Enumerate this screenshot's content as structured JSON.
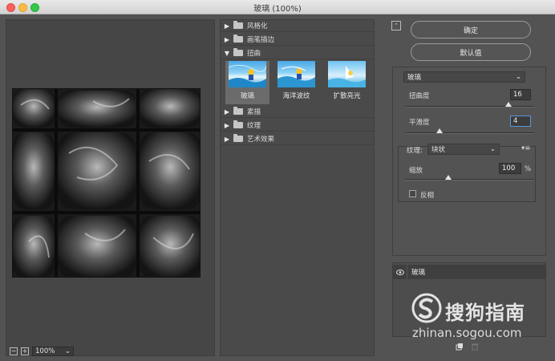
{
  "window": {
    "title": "玻璃 (100%)"
  },
  "preview": {
    "zoom": "100%",
    "zoom_out_icon": "minus-box-icon",
    "zoom_in_icon": "plus-box-icon"
  },
  "browser": {
    "categories_top": [
      {
        "label": "风格化",
        "expanded": false
      },
      {
        "label": "画笔描边",
        "expanded": false
      },
      {
        "label": "扭曲",
        "expanded": true
      }
    ],
    "thumbnails": [
      {
        "label": "玻璃",
        "selected": true
      },
      {
        "label": "海洋波纹",
        "selected": false
      },
      {
        "label": "扩散亮光",
        "selected": false
      }
    ],
    "categories_bottom": [
      {
        "label": "素描",
        "expanded": false
      },
      {
        "label": "纹理",
        "expanded": false
      },
      {
        "label": "艺术效果",
        "expanded": false
      }
    ]
  },
  "actions": {
    "ok_label": "确定",
    "default_label": "默认值"
  },
  "settings": {
    "filter_select": "玻璃",
    "distortion": {
      "label": "扭曲度",
      "value": "16",
      "max": 20
    },
    "smoothness": {
      "label": "平滑度",
      "value": "4",
      "max": 15
    },
    "texture": {
      "label": "纹理:",
      "value": "块状"
    },
    "scaling": {
      "label": "缩放",
      "value": "100",
      "unit": "%",
      "min": 50,
      "max": 200
    },
    "invert": {
      "label": "反相",
      "checked": false
    }
  },
  "layers": [
    {
      "name": "玻璃",
      "visible": true
    }
  ],
  "watermark": {
    "brand": "搜狗指南",
    "url": "zhinan.sogou.com"
  }
}
